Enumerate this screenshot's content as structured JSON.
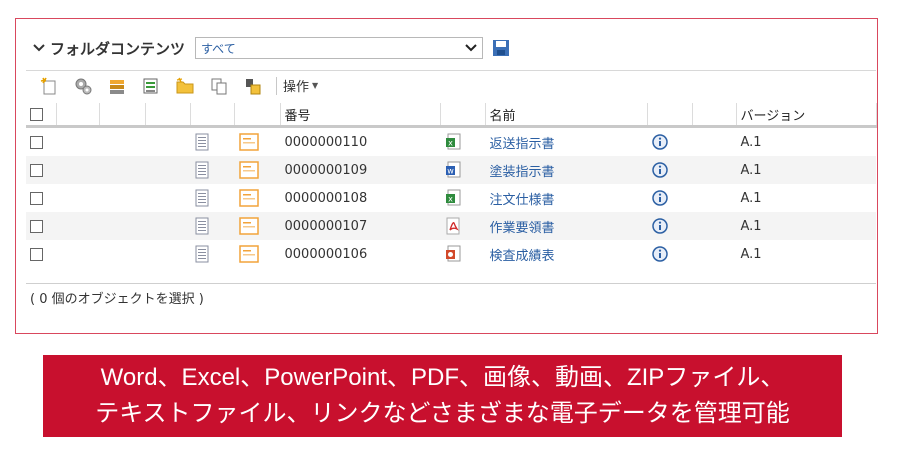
{
  "panel": {
    "title": "フォルダコンテンツ",
    "filter_value": "すべて",
    "save_icon": "save-icon"
  },
  "toolbar": {
    "icons": [
      "new-object-icon",
      "settings-icon",
      "import-icon",
      "checklist-icon",
      "folder-icon",
      "copy-icon",
      "move-icon"
    ],
    "operations_label": "操作"
  },
  "table": {
    "columns": {
      "number": "番号",
      "name": "名前",
      "version": "バージョン"
    },
    "rows": [
      {
        "number": "0000000110",
        "file_type": "excel",
        "name": "返送指示書",
        "version": "A.1"
      },
      {
        "number": "0000000109",
        "file_type": "word",
        "name": "塗装指示書",
        "version": "A.1"
      },
      {
        "number": "0000000108",
        "file_type": "excel",
        "name": "注文仕様書",
        "version": "A.1"
      },
      {
        "number": "0000000107",
        "file_type": "pdf",
        "name": "作業要領書",
        "version": "A.1"
      },
      {
        "number": "0000000106",
        "file_type": "powerpoint",
        "name": "検査成績表",
        "version": "A.1"
      }
    ]
  },
  "footer": {
    "status": "( 0 個のオブジェクトを選択 )"
  },
  "caption": {
    "line1": "Word、Excel、PowerPoint、PDF、画像、動画、ZIPファイル、",
    "line2": "テキストファイル、リンクなどさまざまな電子データを管理可能"
  },
  "colors": {
    "frame_border": "#d9475d",
    "link": "#2b5fa3",
    "caption_bg": "#c8102e"
  }
}
